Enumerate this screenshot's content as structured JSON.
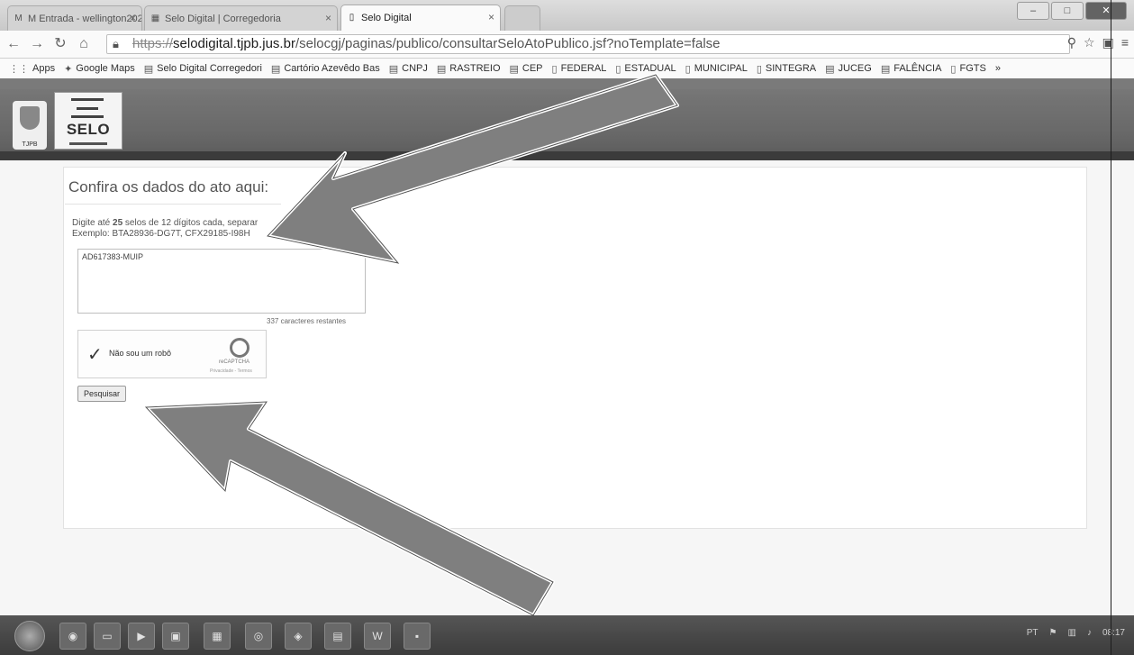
{
  "browser": {
    "tabs": [
      {
        "label": "M Entrada - wellington2021",
        "icon": "mail-icon"
      },
      {
        "label": "Selo Digital | Corregedoria",
        "icon": "doc-icon"
      },
      {
        "label": "Selo Digital",
        "icon": "page-icon",
        "active": true
      }
    ],
    "url": {
      "scheme": "https://",
      "host": "selodigital.tjpb.jus.br",
      "path": "/selocgj/paginas/publico/consultarSeloAtoPublico.jsf?noTemplate=false"
    },
    "bookmarks": [
      {
        "label": "Apps",
        "icon": "apps-icon"
      },
      {
        "label": "Google Maps",
        "icon": "map-icon"
      },
      {
        "label": "Selo Digital Corregedori",
        "icon": "doc-icon"
      },
      {
        "label": "Cartório Azevêdo Bas",
        "icon": "doc-icon"
      },
      {
        "label": "CNPJ",
        "icon": "doc-icon"
      },
      {
        "label": "RASTREIO",
        "icon": "doc-icon"
      },
      {
        "label": "CEP",
        "icon": "doc-icon"
      },
      {
        "label": "FEDERAL",
        "icon": "folder-icon"
      },
      {
        "label": "ESTADUAL",
        "icon": "folder-icon"
      },
      {
        "label": "MUNICIPAL",
        "icon": "folder-icon"
      },
      {
        "label": "SINTEGRA",
        "icon": "folder-icon"
      },
      {
        "label": "JUCEG",
        "icon": "doc-icon"
      },
      {
        "label": "FALÊNCIA",
        "icon": "doc-icon"
      },
      {
        "label": "FGTS",
        "icon": "folder-icon"
      }
    ],
    "bookmarks_overflow": "»"
  },
  "site": {
    "crest_label": "TJPB",
    "logo_text": "SELO"
  },
  "form": {
    "title": "Confira os dados do ato aqui:",
    "instruction_line1_prefix": "Digite até ",
    "instruction_bold": "25",
    "instruction_line1_suffix": " selos de 12 dígitos cada, separar",
    "instruction_line2": "Exemplo: BTA28936-DG7T, CFX29185-I98H",
    "seal_value": "AD617383-MUIP",
    "counter_text": "337 caracteres restantes",
    "captcha_label": "Não sou um robô",
    "captcha_brand": "reCAPTCHA",
    "captcha_sub": "Privacidade - Termos",
    "search_label": "Pesquisar"
  },
  "taskbar": {
    "clock": "08:17",
    "language": "PT",
    "apps": [
      "chrome",
      "explorer",
      "media",
      "office",
      "calculator",
      "chrome2",
      "network",
      "pdf",
      "word",
      "save"
    ]
  },
  "colors": {
    "banner": "#6a6a6a",
    "panel": "#ffffff",
    "arrow_fill": "#7f7f7f",
    "arrow_outline": "#ffffff"
  }
}
